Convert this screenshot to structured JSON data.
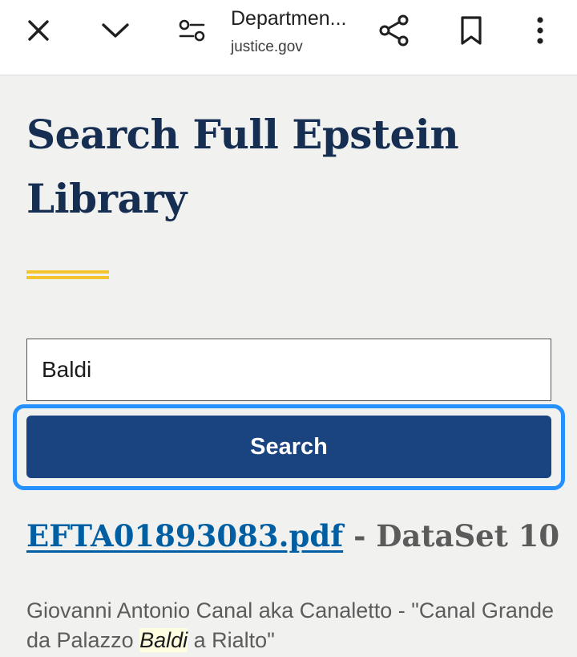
{
  "browser": {
    "title": "Departmen...",
    "domain": "justice.gov",
    "icons": {
      "close": "close-icon",
      "chevron": "chevron-down-icon",
      "settings": "page-settings-icon",
      "share": "share-icon",
      "bookmark": "bookmark-icon",
      "more": "more-vertical-icon"
    }
  },
  "page": {
    "title": "Search Full Epstein Library",
    "accent_color": "#f5c32c",
    "title_color": "#162e51"
  },
  "search": {
    "value": "Baldi",
    "button_label": "Search",
    "button_color": "#1a4480",
    "focus_ring_color": "#2491ff"
  },
  "results": [
    {
      "filename": "EFTA01893083.pdf",
      "separator": "-",
      "dataset": "DataSet 10",
      "snippet_before": "Giovanni Antonio Canal aka Canaletto - \"Canal Grande da Palazzo ",
      "snippet_highlight": "Baldi",
      "snippet_after": " a Rialto\""
    }
  ]
}
